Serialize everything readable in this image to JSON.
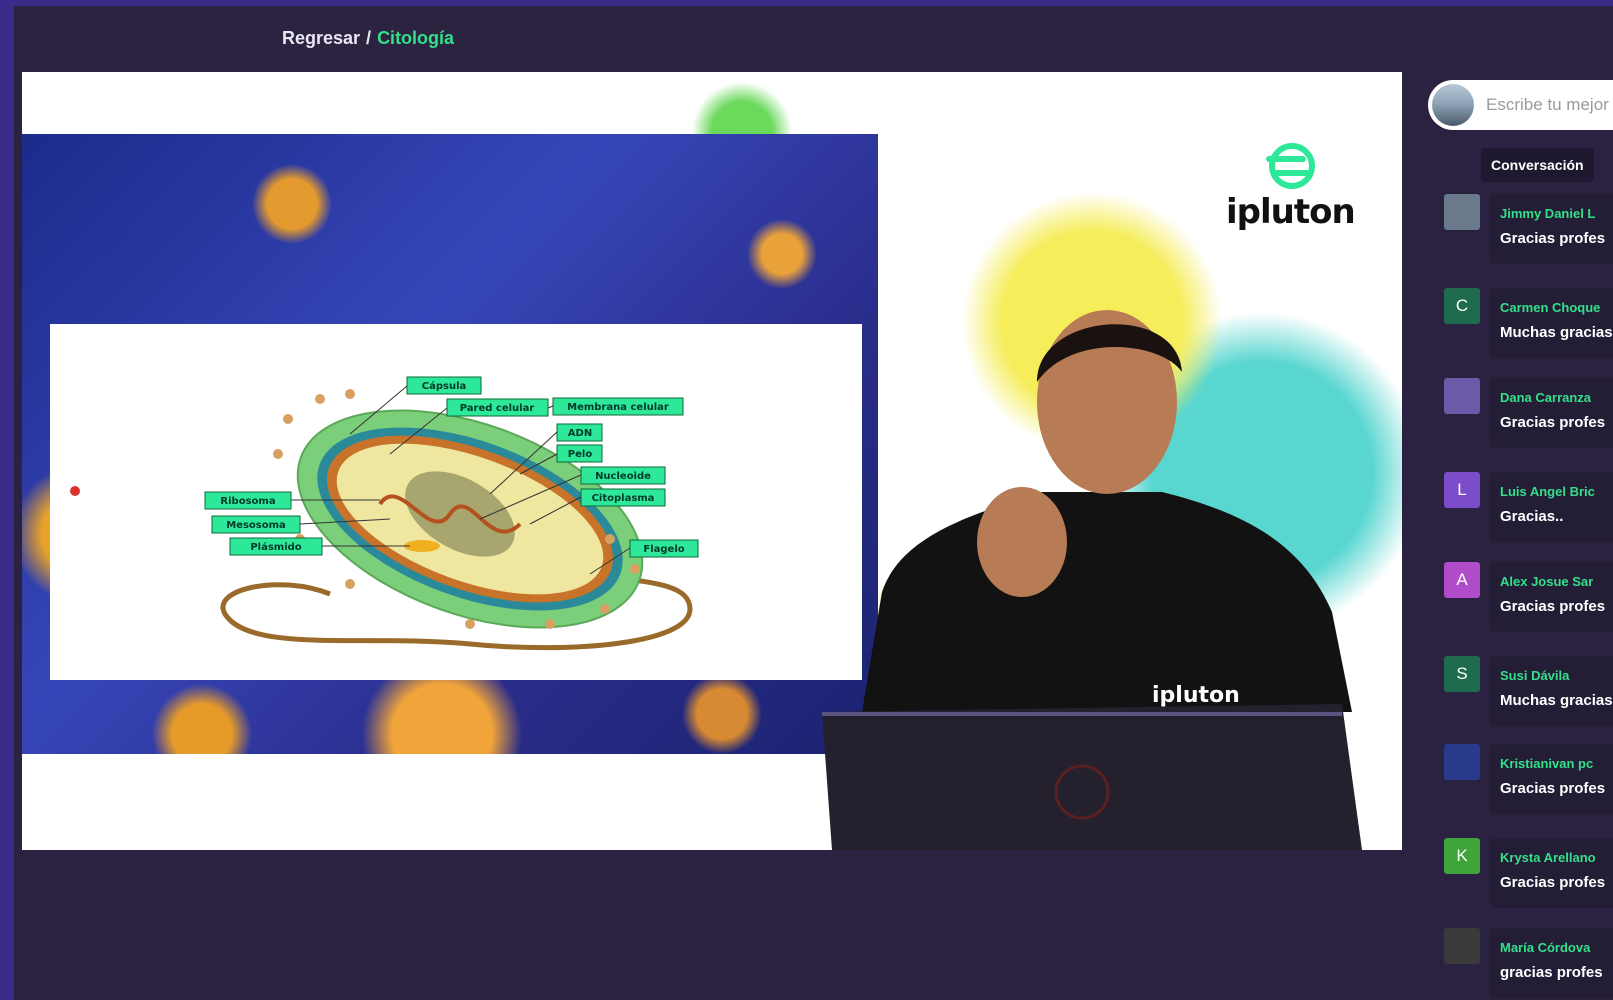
{
  "header": {
    "back_label": "Regresar",
    "separator": "/",
    "current_label": "Citología"
  },
  "video": {
    "logo_text": "ipluton",
    "shirt_text": "ipluton",
    "diagram_labels": {
      "capsula": "Cápsula",
      "pared": "Pared celular",
      "membrana": "Membrana celular",
      "adn": "ADN",
      "pelo": "Pelo",
      "nucleoide": "Nucleoide",
      "citoplasma": "Citoplasma",
      "ribosoma": "Ribosoma",
      "mesosoma": "Mesosoma",
      "plasmido": "Plásmido",
      "flagelo": "Flagelo"
    }
  },
  "sidebar": {
    "comment_placeholder": "Escribe tu mejor comentario",
    "tab_label": "Conversación",
    "messages": [
      {
        "initial": "",
        "avatar_color": "#6b7a8a",
        "name": "Jimmy Daniel L",
        "text": "Gracias profes"
      },
      {
        "initial": "C",
        "avatar_color": "#1f6b4e",
        "name": "Carmen Choque",
        "text": "Muchas gracias"
      },
      {
        "initial": "",
        "avatar_color": "#6a5aa8",
        "name": "Dana Carranza",
        "text": "Gracias profes"
      },
      {
        "initial": "L",
        "avatar_color": "#7b4cc9",
        "name": "Luis Angel Bric",
        "text": "Gracias.."
      },
      {
        "initial": "A",
        "avatar_color": "#b04cc9",
        "name": "Alex Josue Sar",
        "text": "Gracias profes"
      },
      {
        "initial": "S",
        "avatar_color": "#1f6b4e",
        "name": "Susi Dávila",
        "text": "Muchas gracias"
      },
      {
        "initial": "",
        "avatar_color": "#2a3a8a",
        "name": "Kristianivan pc",
        "text": "Gracias profes"
      },
      {
        "initial": "K",
        "avatar_color": "#3fa53a",
        "name": "Krysta Arellano",
        "text": "Gracias profes"
      },
      {
        "initial": "",
        "avatar_color": "#3a3a3a",
        "name": "María Córdova",
        "text": "gracias profes"
      }
    ]
  },
  "colors": {
    "background": "#2a2240",
    "accent_green": "#33e08a",
    "frame": "#3a2a8a"
  }
}
